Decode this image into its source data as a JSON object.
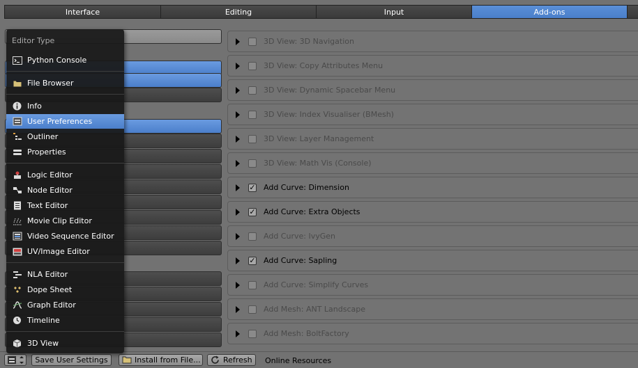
{
  "tabs": [
    "Interface",
    "Editing",
    "Input",
    "Add-ons"
  ],
  "active_tab": "Add-ons",
  "menu": {
    "title": "Editor Type",
    "items": [
      {
        "label": "Python Console",
        "icon": "python-console-icon"
      },
      {
        "label": "File Browser",
        "icon": "folder-icon"
      },
      {
        "label": "Info",
        "icon": "info-icon"
      },
      {
        "label": "User Preferences",
        "icon": "preferences-icon"
      },
      {
        "label": "Outliner",
        "icon": "outliner-icon"
      },
      {
        "label": "Properties",
        "icon": "properties-icon"
      },
      {
        "label": "Logic Editor",
        "icon": "logic-icon"
      },
      {
        "label": "Node Editor",
        "icon": "node-icon"
      },
      {
        "label": "Text Editor",
        "icon": "text-icon"
      },
      {
        "label": "Movie Clip Editor",
        "icon": "clip-icon"
      },
      {
        "label": "Video Sequence Editor",
        "icon": "sequencer-icon"
      },
      {
        "label": "UV/Image Editor",
        "icon": "image-icon"
      },
      {
        "label": "NLA Editor",
        "icon": "nla-icon"
      },
      {
        "label": "Dope Sheet",
        "icon": "dopesheet-icon"
      },
      {
        "label": "Graph Editor",
        "icon": "graph-icon"
      },
      {
        "label": "Timeline",
        "icon": "timeline-icon"
      },
      {
        "label": "3D View",
        "icon": "3d-view-icon"
      }
    ],
    "selected": "User Preferences"
  },
  "addons": [
    {
      "label": "3D View: 3D Navigation",
      "enabled": false
    },
    {
      "label": "3D View: Copy Attributes Menu",
      "enabled": false
    },
    {
      "label": "3D View: Dynamic Spacebar Menu",
      "enabled": false
    },
    {
      "label": "3D View: Index Visualiser (BMesh)",
      "enabled": false
    },
    {
      "label": "3D View: Layer Management",
      "enabled": false
    },
    {
      "label": "3D View: Math Vis (Console)",
      "enabled": false
    },
    {
      "label": "Add Curve: Dimension",
      "enabled": true
    },
    {
      "label": "Add Curve: Extra Objects",
      "enabled": true
    },
    {
      "label": "Add Curve: IvyGen",
      "enabled": false
    },
    {
      "label": "Add Curve: Sapling",
      "enabled": true
    },
    {
      "label": "Add Curve: Simplify Curves",
      "enabled": false
    },
    {
      "label": "Add Mesh: ANT Landscape",
      "enabled": false
    },
    {
      "label": "Add Mesh: BoltFactory",
      "enabled": false
    }
  ],
  "bottom": {
    "save": "Save User Settings",
    "install": "Install from File...",
    "refresh": "Refresh",
    "online": "Online Resources"
  },
  "colors": {
    "accent": "#5a8fd8",
    "background": "#727272",
    "menu_bg": "#191919"
  }
}
